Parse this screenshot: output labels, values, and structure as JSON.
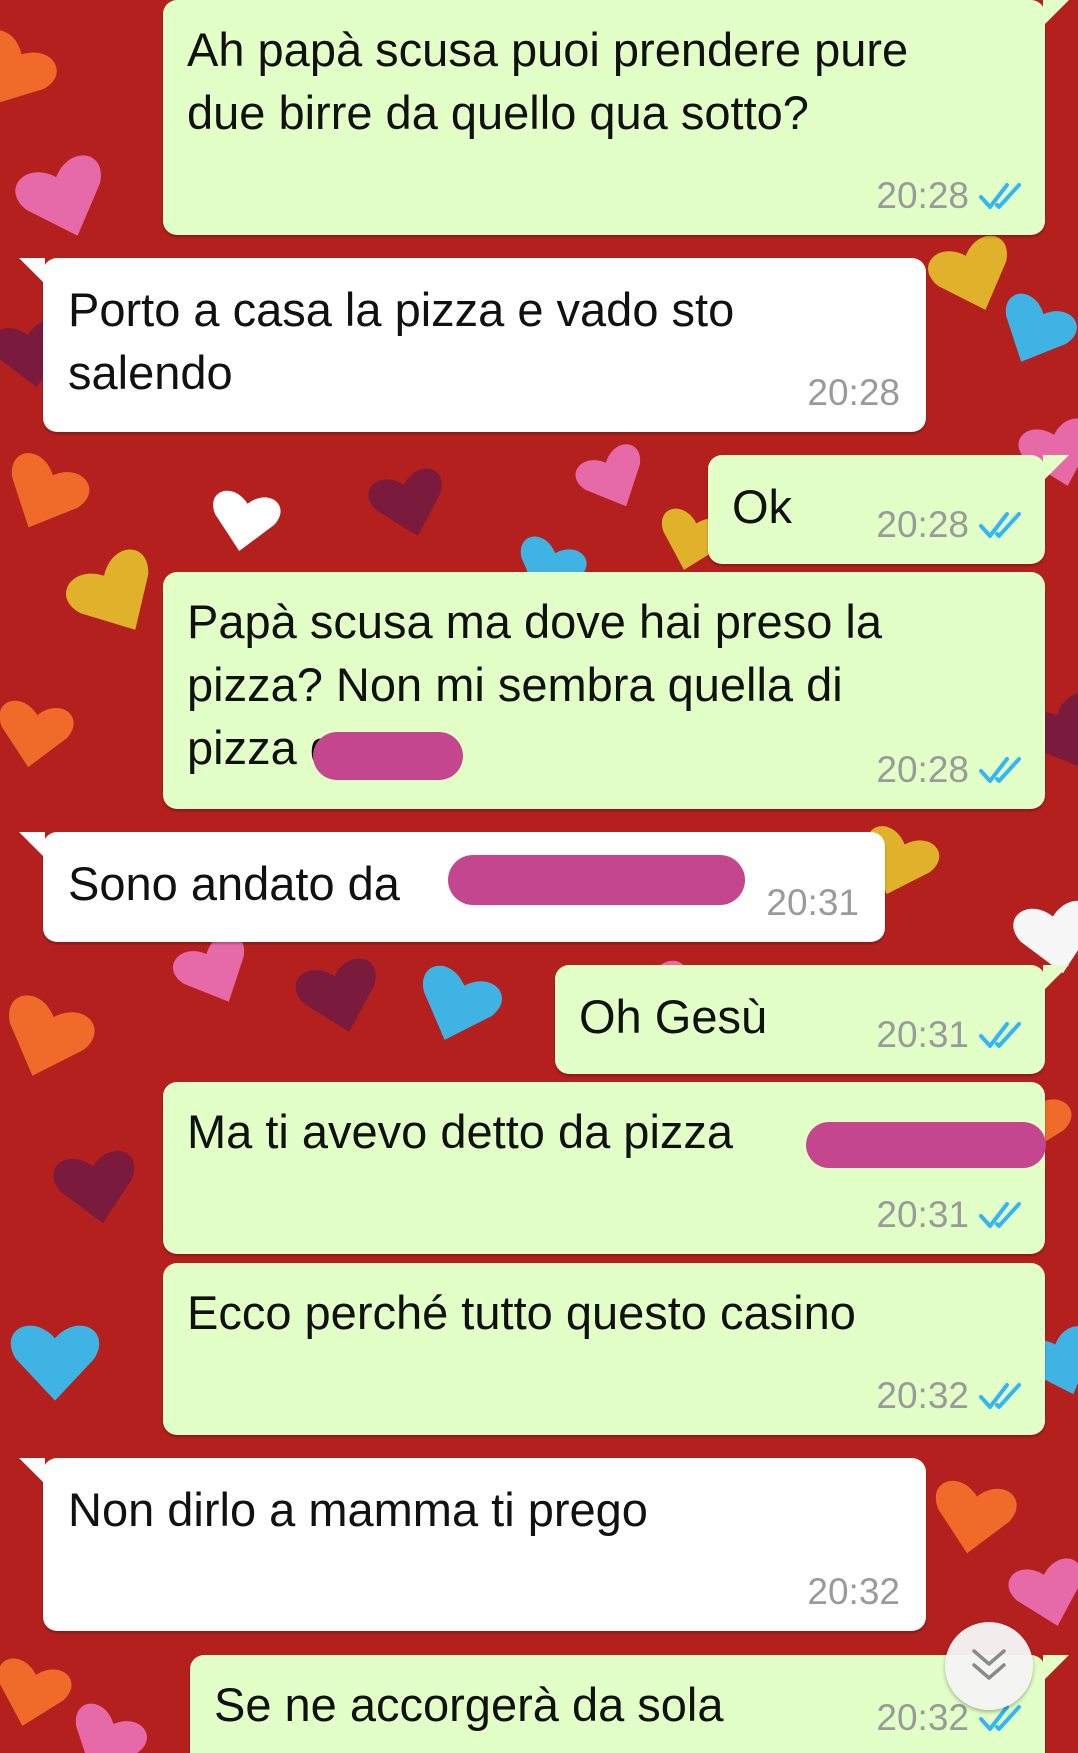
{
  "colors": {
    "outgoing_bubble": "#e2ffc7",
    "incoming_bubble": "#ffffff",
    "timestamp": "#9a9a9a",
    "read_ticks": "#34b7f1",
    "wallpaper": "#b4201d",
    "redaction": "#c4468f"
  },
  "messages": [
    {
      "direction": "out",
      "text": "Ah papà scusa puoi prendere pure\ndue birre da quello qua sotto?",
      "time": "20:28",
      "status": "read"
    },
    {
      "direction": "in",
      "text": "Porto a casa la pizza e vado sto\nsalendo",
      "time": "20:28"
    },
    {
      "direction": "out",
      "text": "Ok",
      "time": "20:28",
      "status": "read"
    },
    {
      "direction": "out",
      "text": "Papà scusa ma dove hai preso la\npizza? Non mi sembra quella di\npizza            questa",
      "time": "20:28",
      "status": "read"
    },
    {
      "direction": "in",
      "text": "Sono andato da",
      "time": "20:31"
    },
    {
      "direction": "out",
      "text": "Oh Gesù",
      "time": "20:31",
      "status": "read"
    },
    {
      "direction": "out",
      "text": "Ma ti avevo detto da pizza",
      "time": "20:31",
      "status": "read"
    },
    {
      "direction": "out",
      "text": "Ecco perché tutto questo casino",
      "time": "20:32",
      "status": "read"
    },
    {
      "direction": "in",
      "text": "Non dirlo a mamma ti prego",
      "time": "20:32"
    },
    {
      "direction": "out",
      "text": "Se ne accorgerà da sola",
      "time": "20:32",
      "status": "read"
    }
  ],
  "icons": {
    "read_receipt": "double-check-icon",
    "scroll_down": "chevron-double-down-icon"
  }
}
